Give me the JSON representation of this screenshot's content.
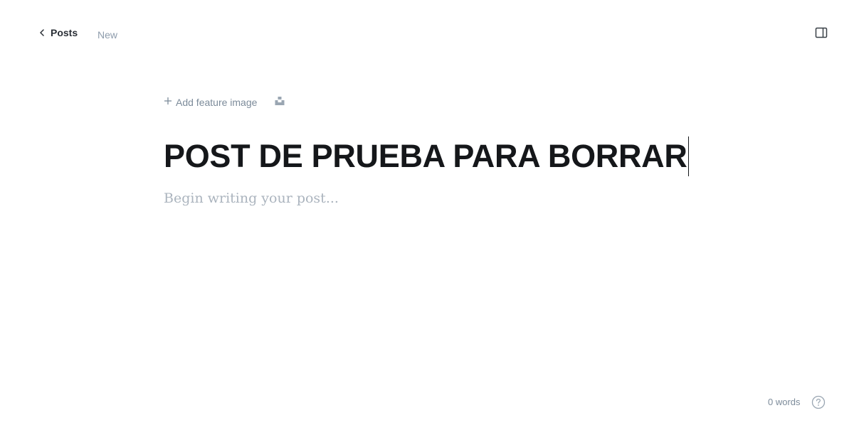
{
  "topbar": {
    "back_label": "Posts",
    "status": "New",
    "back_icon": "chevron-left-icon",
    "sidebar_icon": "sidebar-panel-icon"
  },
  "editor": {
    "add_feature_label": "Add feature image",
    "add_icon": "plus-icon",
    "unsplash_icon": "unsplash-icon",
    "title": "POST DE PRUEBA PARA BORRAR",
    "body_placeholder": "Begin writing your post..."
  },
  "footer": {
    "word_count": "0 words",
    "help_icon": "question-circle-icon"
  },
  "colors": {
    "text_primary": "#15171a",
    "text_muted": "#7c8b9a",
    "placeholder": "#abb4be"
  }
}
